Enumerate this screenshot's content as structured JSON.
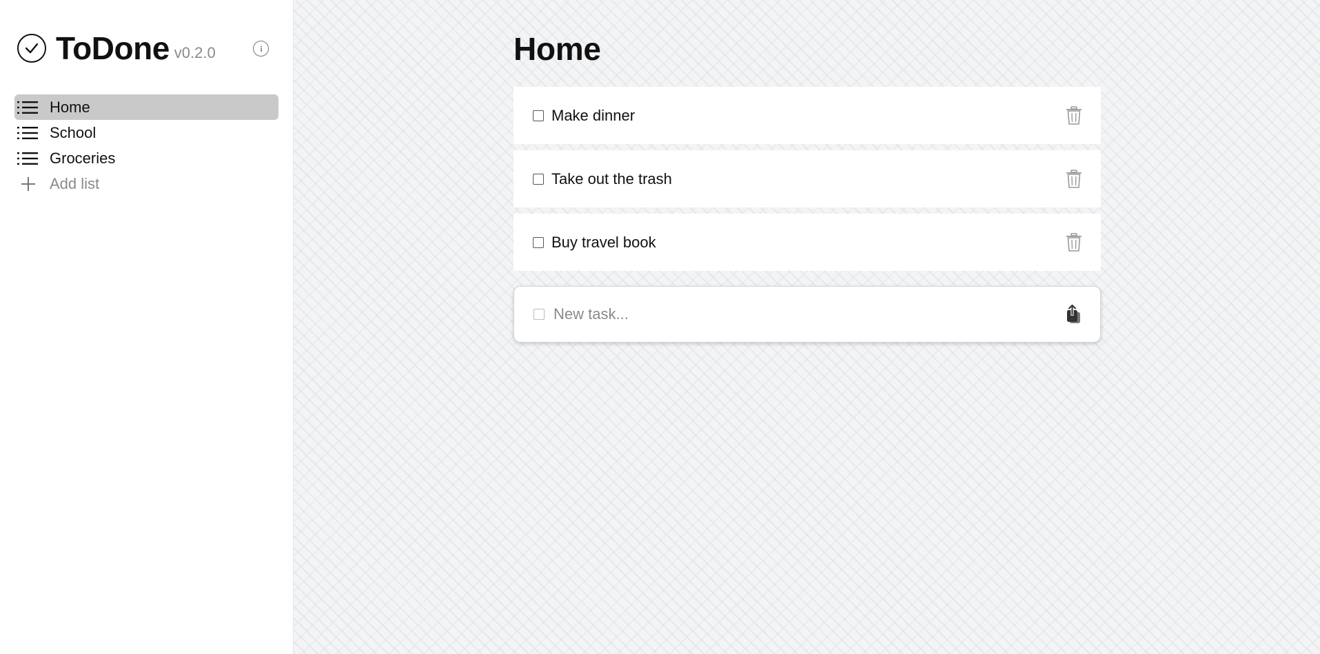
{
  "app": {
    "title": "ToDone",
    "version": "v0.2.0",
    "logo_icon": "check-circle-icon",
    "info_icon": "info-icon"
  },
  "sidebar": {
    "items": [
      {
        "label": "Home",
        "icon": "list-icon",
        "active": true
      },
      {
        "label": "School",
        "icon": "list-icon",
        "active": false
      },
      {
        "label": "Groceries",
        "icon": "list-icon",
        "active": false
      }
    ],
    "add_list_label": "Add list",
    "add_list_icon": "plus-icon"
  },
  "main": {
    "title": "Home",
    "tasks": [
      {
        "label": "Make dinner",
        "checked": false
      },
      {
        "label": "Take out the trash",
        "checked": false
      },
      {
        "label": "Buy travel book",
        "checked": false
      }
    ],
    "delete_icon": "trash-icon",
    "new_task": {
      "placeholder": "New task...",
      "value": "",
      "submit_icon": "share-upload-icon"
    }
  },
  "colors": {
    "active_item_bg": "#c9c9c9",
    "main_bg": "#f3f4f6",
    "muted_text": "#8a8a8e"
  }
}
